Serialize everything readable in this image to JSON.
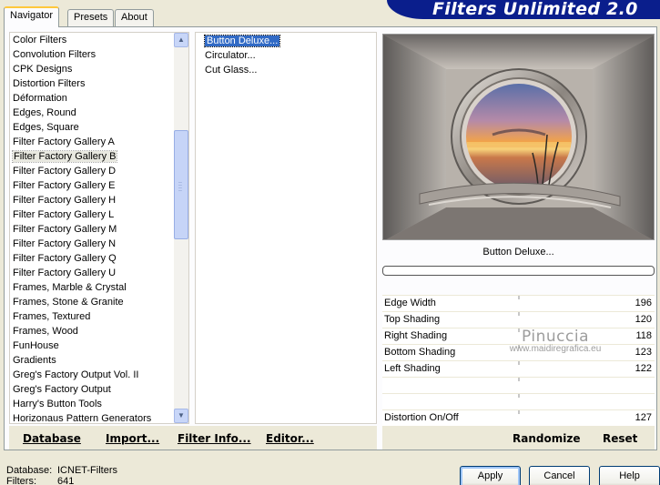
{
  "window": {
    "banner_title": "Filters Unlimited 2.0"
  },
  "tabs": [
    {
      "label": "Navigator",
      "active": true
    },
    {
      "label": "Presets",
      "active": false
    },
    {
      "label": "About",
      "active": false
    }
  ],
  "categories": [
    {
      "label": "Color Filters"
    },
    {
      "label": "Convolution Filters"
    },
    {
      "label": "CPK Designs"
    },
    {
      "label": "Distortion Filters"
    },
    {
      "label": "Déformation"
    },
    {
      "label": "Edges, Round"
    },
    {
      "label": "Edges, Square"
    },
    {
      "label": "Filter Factory Gallery A"
    },
    {
      "label": "Filter Factory Gallery B",
      "selected": true
    },
    {
      "label": "Filter Factory Gallery D"
    },
    {
      "label": "Filter Factory Gallery E"
    },
    {
      "label": "Filter Factory Gallery H"
    },
    {
      "label": "Filter Factory Gallery L"
    },
    {
      "label": "Filter Factory Gallery M"
    },
    {
      "label": "Filter Factory Gallery N"
    },
    {
      "label": "Filter Factory Gallery Q"
    },
    {
      "label": "Filter Factory Gallery U"
    },
    {
      "label": "Frames, Marble & Crystal"
    },
    {
      "label": "Frames, Stone & Granite"
    },
    {
      "label": "Frames, Textured"
    },
    {
      "label": "Frames, Wood"
    },
    {
      "label": "FunHouse"
    },
    {
      "label": "Gradients"
    },
    {
      "label": "Greg's Factory Output Vol. II"
    },
    {
      "label": "Greg's Factory Output"
    },
    {
      "label": "Harry's Button Tools"
    },
    {
      "label": "Horizonaus Pattern Generators"
    }
  ],
  "filters": [
    {
      "label": "Button Deluxe...",
      "selected": true
    },
    {
      "label": "Circulator..."
    },
    {
      "label": "Cut Glass..."
    }
  ],
  "bottom_left": {
    "database_label": "Database",
    "import_label": "Import...",
    "filter_info_label": "Filter Info...",
    "editor_label": "Editor..."
  },
  "preview": {
    "filter_name": "Button Deluxe...",
    "progress": 0
  },
  "params": [
    {
      "label": "Edge Width",
      "value": "196"
    },
    {
      "label": "Top Shading",
      "value": "120"
    },
    {
      "label": "Right Shading",
      "value": "118"
    },
    {
      "label": "Bottom Shading",
      "value": "123"
    },
    {
      "label": "Left Shading",
      "value": "122"
    },
    {
      "label": "",
      "value": ""
    },
    {
      "label": "",
      "value": ""
    },
    {
      "label": "Distortion On/Off",
      "value": "127"
    }
  ],
  "watermark": {
    "line1": "Pinuccia",
    "line2": "www.maidiregrafica.eu"
  },
  "bottom_right": {
    "randomize_label": "Randomize",
    "reset_label": "Reset"
  },
  "footer": {
    "database_key": "Database:",
    "database_value": "ICNET-Filters",
    "filters_key": "Filters:",
    "filters_value": "641",
    "apply_label": "Apply",
    "cancel_label": "Cancel",
    "help_label": "Help"
  },
  "colors": {
    "banner": "#0a1e8c",
    "selection": "#316ac5",
    "dialog_bg": "#ece9d8"
  }
}
